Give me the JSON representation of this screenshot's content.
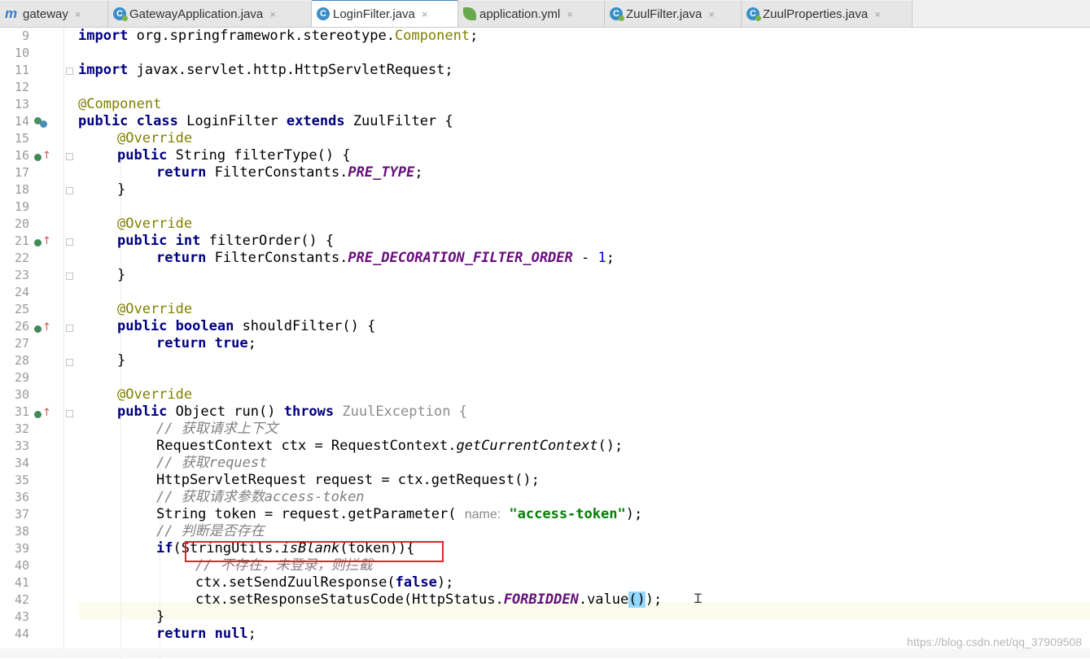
{
  "tabs": [
    {
      "label": "gateway",
      "icon": "maven-module-icon",
      "active": false
    },
    {
      "label": "GatewayApplication.java",
      "icon": "spring-class-icon",
      "active": false
    },
    {
      "label": "LoginFilter.java",
      "icon": "class-icon",
      "active": true
    },
    {
      "label": "application.yml",
      "icon": "yaml-leaf-icon",
      "active": false
    },
    {
      "label": "ZuulFilter.java",
      "icon": "abstract-class-icon",
      "active": false
    },
    {
      "label": "ZuulProperties.java",
      "icon": "abstract-class-icon",
      "active": false
    }
  ],
  "tab_close_glyph": "×",
  "line_numbers": [
    "9",
    "10",
    "11",
    "12",
    "13",
    "14",
    "15",
    "16",
    "17",
    "18",
    "19",
    "20",
    "21",
    "22",
    "23",
    "24",
    "25",
    "26",
    "27",
    "28",
    "29",
    "30",
    "31",
    "32",
    "33",
    "34",
    "35",
    "36",
    "37",
    "38",
    "39",
    "40",
    "41",
    "42",
    "43",
    "44"
  ],
  "code": {
    "l9_import": "import",
    "l9_pkg": " org.springframework.stereotype.",
    "l9_cls": "Component",
    "l9_end": ";",
    "l11_import": "import",
    "l11_rest": " javax.servlet.http.HttpServletRequest;",
    "l13_ann": "@Component",
    "l14_public": "public",
    "l14_class": "class",
    "l14_name": " LoginFilter ",
    "l14_extends": "extends",
    "l14_rest": " ZuulFilter {",
    "override": "@Override",
    "l16_public": "public",
    "l16_rest": " String filterType() {",
    "l17_return": "return",
    "l17_mid": " FilterConstants.",
    "l17_const": "PRE_TYPE",
    "l17_end": ";",
    "close_brace": "}",
    "l21_public": "public",
    "l21_int": "int",
    "l21_rest": " filterOrder() {",
    "l22_return": "return",
    "l22_mid": " FilterConstants.",
    "l22_const": "PRE_DECORATION_FILTER_ORDER",
    "l22_minus": " - ",
    "l22_num": "1",
    "l22_end": ";",
    "l26_public": "public",
    "l26_boolean": "boolean",
    "l26_rest": " shouldFilter() {",
    "l27_return": "return",
    "l27_true": "true",
    "l27_end": ";",
    "l31_public": "public",
    "l31_mid": " Object run() ",
    "l31_throws": "throws",
    "l31_exc": " ZuulException {",
    "l32_comment": "// 获取请求上下文",
    "l33_a": "RequestContext ctx = RequestContext.",
    "l33_method": "getCurrentContext",
    "l33_end": "();",
    "l34_comment_a": "// 获取",
    "l34_comment_b": "request",
    "l35": "HttpServletRequest request = ctx.getRequest();",
    "l36_comment_a": "// 获取请求参数",
    "l36_comment_b": "access-token",
    "l37_a": "String token = request.getParameter( ",
    "l37_hint": "name:",
    "l37_str": " \"access-token\"",
    "l37_end": ");",
    "l38_comment": "// 判断是否存在",
    "l39_if": "if",
    "l39_a": "(StringUtils.",
    "l39_method": "isBlank",
    "l39_b": "(token)){",
    "l40_comment": "// 不存在，未登录，则拦截",
    "l41_a": "ctx.setSendZuulResponse(",
    "l41_false": "false",
    "l41_end": ");",
    "l42_a": "ctx.setResponseStatusCode(HttpStatus.",
    "l42_const": "FORBIDDEN",
    "l42_b": ".value",
    "l42_paren": "()",
    "l42_end": ");",
    "l44_return": "return",
    "l44_null": "null",
    "l44_end": ";"
  },
  "watermark": "https://blog.csdn.net/qq_37909508",
  "colors": {
    "keyword": "#000080",
    "annotation": "#808000",
    "constant": "#660e7a",
    "string": "#008000",
    "comment": "#808080",
    "highlight_box": "#e0232a"
  }
}
